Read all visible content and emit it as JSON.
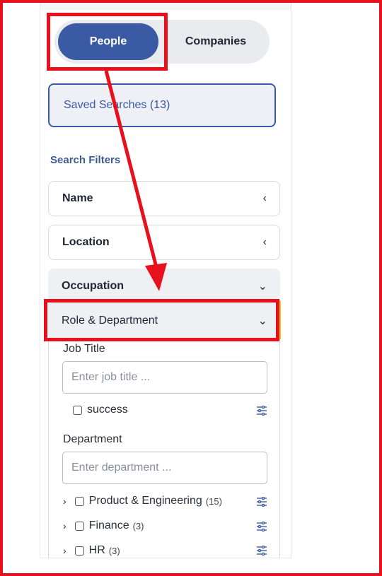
{
  "tabs": {
    "people_label": "People",
    "companies_label": "Companies"
  },
  "saved_searches": {
    "label": "Saved Searches (13)"
  },
  "filters": {
    "section_title": "Search Filters",
    "name_label": "Name",
    "location_label": "Location",
    "occupation_label": "Occupation",
    "role_label": "Role & Department"
  },
  "job_title": {
    "label": "Job Title",
    "placeholder": "Enter job title ...",
    "suggestion": "success"
  },
  "department": {
    "label": "Department",
    "placeholder": "Enter department ...",
    "items": [
      {
        "label": "Product & Engineering",
        "count": "(15)"
      },
      {
        "label": "Finance",
        "count": "(3)"
      },
      {
        "label": "HR",
        "count": "(3)"
      }
    ]
  },
  "icons": {
    "collapsed_chevron": "‹",
    "expanded_chevron": "⌄",
    "expand_arrow": "›"
  },
  "colors": {
    "accent": "#3a5aa4",
    "annotation": "#e8101d",
    "highlight_edge": "#f5c31a"
  }
}
